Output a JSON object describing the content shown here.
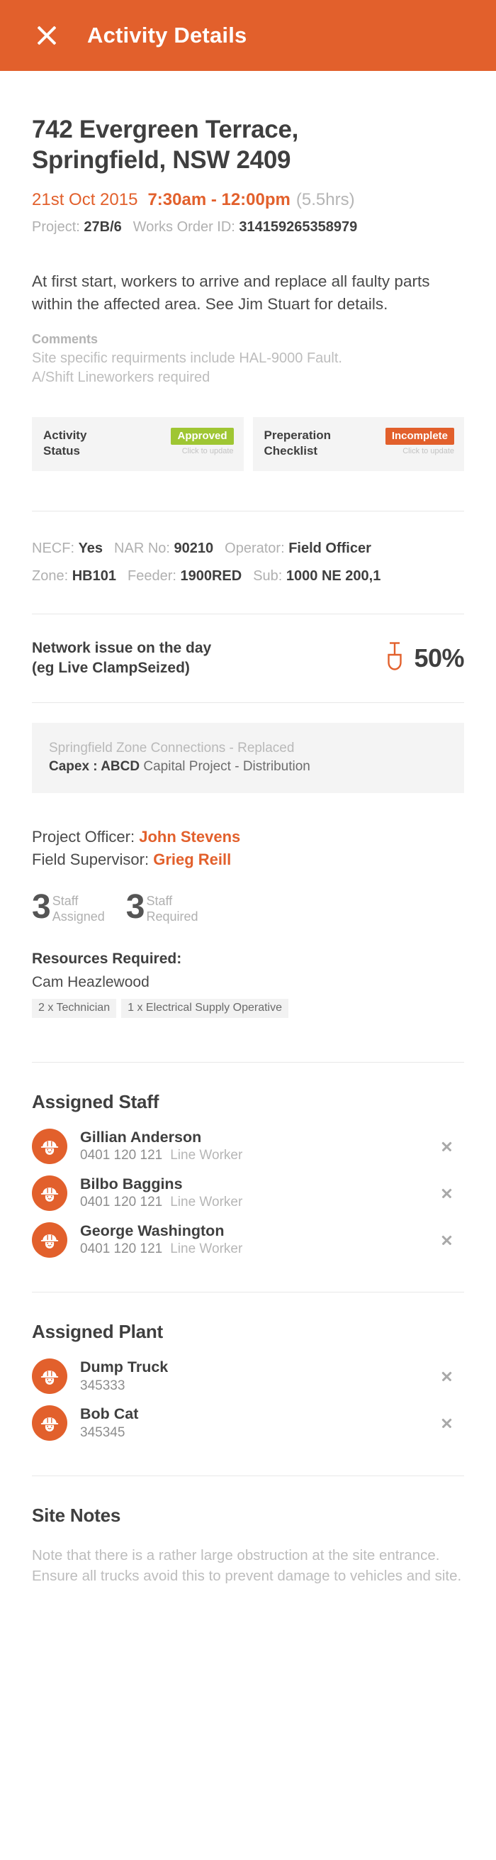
{
  "header": {
    "title": "Activity Details",
    "close_icon": "close-icon",
    "bar_color": "#e2602c"
  },
  "summary": {
    "address_line1": "742 Evergreen Terrace,",
    "address_line2": "Springfield, NSW 2409",
    "date": "21st Oct 2015",
    "time_range": "7:30am - 12:00pm",
    "duration": "(5.5hrs)",
    "project_label": "Project:",
    "project_value": "27B/6",
    "works_order_label": "Works Order ID:",
    "works_order_value": "314159265358979"
  },
  "description": "At first start, workers to arrive and replace all faulty parts within the affected area. See Jim Stuart for details.",
  "comments": {
    "label": "Comments",
    "line1": "Site specific requirments include HAL-9000 Fault.",
    "line2": "A/Shift Lineworkers required"
  },
  "status_cards": [
    {
      "label_line1": "Activity",
      "label_line2": "Status",
      "badge": "Approved",
      "badge_color": "#9fc633",
      "hint": "Click to update"
    },
    {
      "label_line1": "Preperation",
      "label_line2": "Checklist",
      "badge": "Incomplete",
      "badge_color": "#e2602c",
      "hint": "Click to update"
    }
  ],
  "details": {
    "row1": [
      {
        "label": "NECF:",
        "value": "Yes"
      },
      {
        "label": "NAR No:",
        "value": "90210"
      },
      {
        "label": "Operator:",
        "value": "Field Officer"
      }
    ],
    "row2": [
      {
        "label": "Zone:",
        "value": "HB101"
      },
      {
        "label": "Feeder:",
        "value": "1900RED"
      },
      {
        "label": "Sub:",
        "value": "1000 NE 200,1"
      }
    ]
  },
  "network_issue": {
    "label_line1": "Network issue on the day",
    "label_line2": "(eg Live ClampSeized)",
    "icon": "shovel-icon",
    "icon_color": "#e2602c",
    "percent": "50%"
  },
  "capex": {
    "top_line": "Springfield Zone Connections - Replaced",
    "code_label": "Capex : ABCD",
    "code_desc": "Capital Project - Distribution"
  },
  "officers": {
    "project_officer_label": "Project Officer:",
    "project_officer_name": "John Stevens",
    "field_supervisor_label": "Field Supervisor:",
    "field_supervisor_name": "Grieg Reill"
  },
  "counts": [
    {
      "number": "3",
      "caption_line1": "Staff",
      "caption_line2": "Assigned"
    },
    {
      "number": "3",
      "caption_line1": "Staff",
      "caption_line2": "Required"
    }
  ],
  "resources": {
    "title": "Resources Required:",
    "person": "Cam Heazlewood",
    "tags": [
      "2 x Technician",
      "1 x Electrical Supply Operative"
    ]
  },
  "assigned_staff": {
    "title": "Assigned Staff",
    "items": [
      {
        "name": "Gillian Anderson",
        "phone": "0401 120 121",
        "role": "Line Worker",
        "avatar": "hardhat-worker-icon"
      },
      {
        "name": "Bilbo Baggins",
        "phone": "0401 120 121",
        "role": "Line Worker",
        "avatar": "hardhat-worker-icon"
      },
      {
        "name": "George Washington",
        "phone": "0401 120 121",
        "role": "Line Worker",
        "avatar": "hardhat-worker-icon"
      }
    ]
  },
  "assigned_plant": {
    "title": "Assigned Plant",
    "items": [
      {
        "name": "Dump Truck",
        "id": "345333",
        "avatar": "hardhat-worker-icon"
      },
      {
        "name": "Bob Cat",
        "id": "345345",
        "avatar": "hardhat-worker-icon"
      }
    ]
  },
  "site_notes": {
    "title": "Site Notes",
    "text": "Note that there is a rather large obstruction at the site entrance. Ensure all trucks avoid this to prevent damage to vehicles and site."
  }
}
